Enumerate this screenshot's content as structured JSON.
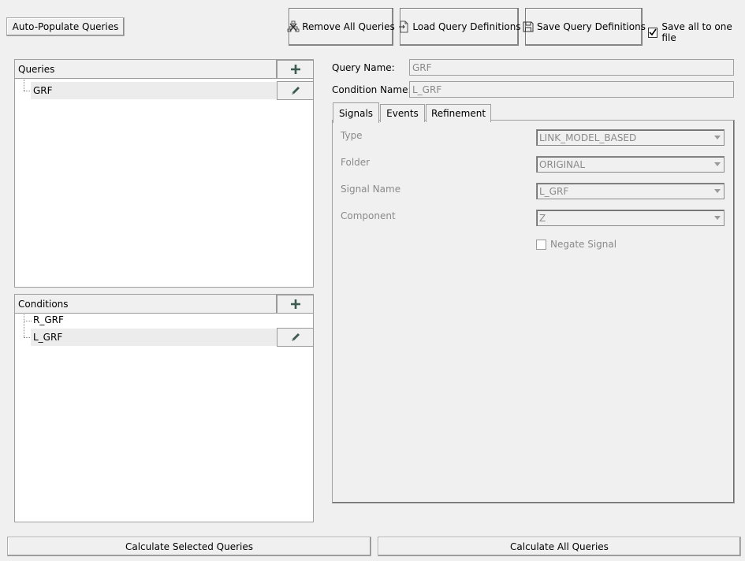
{
  "toolbar": {
    "auto_populate": "Auto-Populate Queries",
    "remove_all": "Remove All Queries",
    "load_defs": "Load Query Definitions",
    "save_defs": "Save Query Definitions",
    "save_all_one_file": "Save all to one file",
    "save_all_checked": true
  },
  "queries": {
    "header": "Queries",
    "items": [
      {
        "label": "GRF",
        "selected": true
      }
    ]
  },
  "conditions": {
    "header": "Conditions",
    "items": [
      {
        "label": "R_GRF",
        "selected": false
      },
      {
        "label": "L_GRF",
        "selected": true
      }
    ]
  },
  "form": {
    "query_name_label": "Query Name:",
    "query_name_value": "GRF",
    "condition_name_label": "Condition Name:",
    "condition_name_value": "L_GRF"
  },
  "tabs": [
    "Signals",
    "Events",
    "Refinement"
  ],
  "active_tab": "Signals",
  "signals": {
    "type_label": "Type",
    "type_value": "LINK_MODEL_BASED",
    "folder_label": "Folder",
    "folder_value": "ORIGINAL",
    "signal_name_label": "Signal Name",
    "signal_name_value": "L_GRF",
    "component_label": "Component",
    "component_value": "Z",
    "negate_label": "Negate Signal",
    "negate_checked": false
  },
  "footer": {
    "calc_selected": "Calculate Selected Queries",
    "calc_all": "Calculate All Queries"
  },
  "colors": {
    "background": "#f0f0f0",
    "icon": "#3c5a50",
    "disabled_text": "#8a8a8a"
  }
}
